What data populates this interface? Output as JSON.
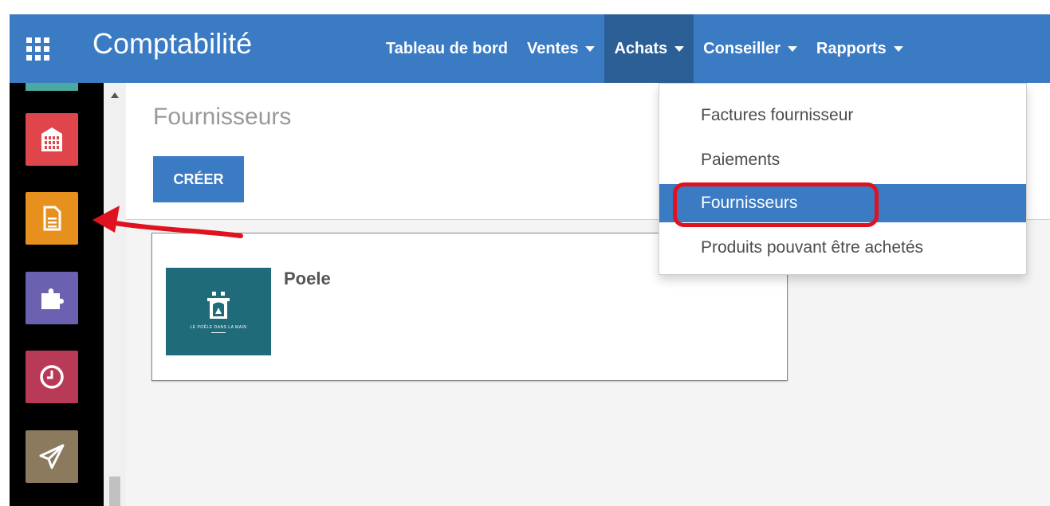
{
  "topbar": {
    "app_title": "Comptabilité",
    "apps_icon": "grid-icon",
    "menus": [
      {
        "label": "Tableau de bord",
        "has_caret": false
      },
      {
        "label": "Ventes",
        "has_caret": true
      },
      {
        "label": "Achats",
        "has_caret": true
      },
      {
        "label": "Conseiller",
        "has_caret": true
      },
      {
        "label": "Rapports",
        "has_caret": true
      }
    ],
    "colors": {
      "bar": "#3a7bc4",
      "active": "#2b5f96"
    }
  },
  "dock": {
    "apps": [
      {
        "icon": "building-icon",
        "color": "#e0454b"
      },
      {
        "icon": "document-icon",
        "color": "#e8901e"
      },
      {
        "icon": "puzzle-icon",
        "color": "#6a62b0"
      },
      {
        "icon": "clock-icon",
        "color": "#b93a57"
      },
      {
        "icon": "paper-plane-icon",
        "color": "#8b7a5e"
      }
    ]
  },
  "main": {
    "breadcrumb": "Fournisseurs",
    "create_label": "CRÉER",
    "card": {
      "title": "Poele",
      "logo_text": "LE POÊLE DANS LA MAIN"
    }
  },
  "dropdown": {
    "items": [
      {
        "label": "Factures fournisseur",
        "selected": false
      },
      {
        "label": "Paiements",
        "selected": false
      },
      {
        "label": "Fournisseurs",
        "selected": true
      },
      {
        "label": "Produits pouvant être achetés",
        "selected": false
      }
    ]
  },
  "annotation": {
    "color": "#e1121f"
  }
}
